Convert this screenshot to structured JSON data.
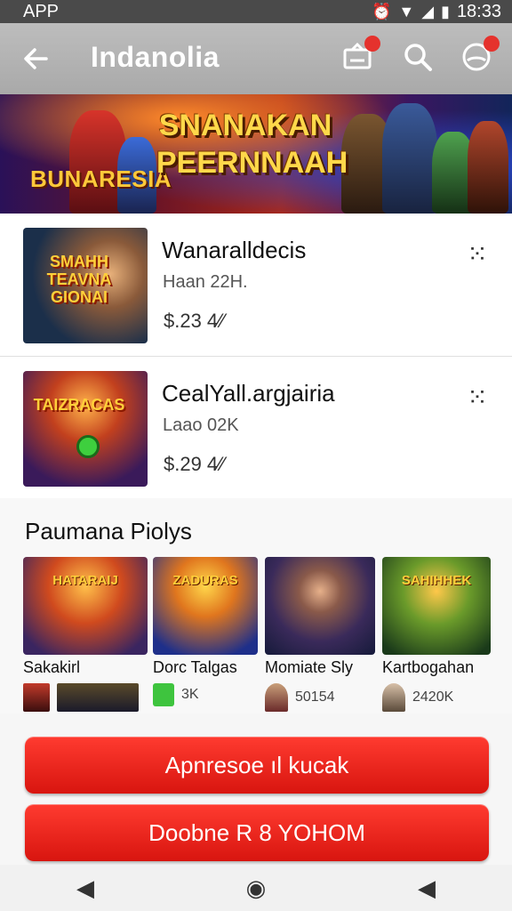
{
  "status_bar": {
    "left": "APP",
    "time": "18:33"
  },
  "app_bar": {
    "title": "Indanolia"
  },
  "banner": {
    "title": "SNANAKAN PEERNNAAH",
    "subtitle": "BUNARESIA"
  },
  "list": [
    {
      "thumb_text": "SMAHH TEAVNA GIONAI",
      "title": "Wanaralldecis",
      "subtitle": "Haan 22H.",
      "price": "$.23 4⁄⁄"
    },
    {
      "thumb_text": "TAIZRACAS",
      "title": "CealYall.argjairia",
      "subtitle": "Laao 02K",
      "price": "$.29 4⁄⁄"
    }
  ],
  "section": {
    "title": "Paumana Piolys",
    "cards": [
      {
        "img_text": "HATARAIJ",
        "name": "Sakakirl",
        "stat": ""
      },
      {
        "img_text": "ZADURAS",
        "name": "Dorc Talgas",
        "stat": "3K"
      },
      {
        "img_text": "",
        "name": "Momiate Sly",
        "stat": "50154"
      },
      {
        "img_text": "SAHIHHEK",
        "name": "Kartbogahan",
        "stat": "2420K"
      }
    ]
  },
  "buttons": {
    "primary": "Apnresoe ıl kucak",
    "secondary": "Doobne R 8 YOHOM"
  },
  "colors": {
    "accent": "#e01b16",
    "app_bar": "#b3b3b3",
    "status_bar": "#4a4a4a"
  },
  "icons": {
    "back": "back-arrow-icon",
    "cast": "cast-icon",
    "search": "search-icon",
    "profile": "profile-icon",
    "more": "more-dots-icon",
    "nav_back": "nav-back-icon",
    "nav_home": "nav-home-icon",
    "nav_recent": "nav-recent-icon"
  }
}
